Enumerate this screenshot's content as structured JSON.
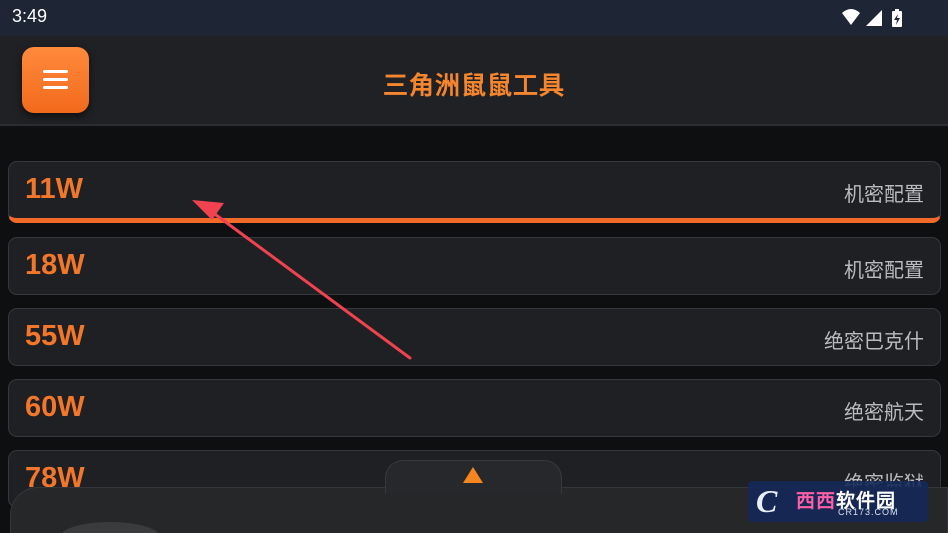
{
  "status_bar": {
    "time": "3:49",
    "icons": [
      "wifi-icon",
      "signal-icon",
      "battery-charging-icon"
    ]
  },
  "app_bar": {
    "menu_icon": "hamburger-menu-icon",
    "title": "三角洲鼠鼠工具",
    "accent_color": "#f5862e"
  },
  "list": {
    "items": [
      {
        "power": "11W",
        "label": "机密配置",
        "selected": true
      },
      {
        "power": "18W",
        "label": "机密配置",
        "selected": false
      },
      {
        "power": "55W",
        "label": "绝密巴克什",
        "selected": false
      },
      {
        "power": "60W",
        "label": "绝密航天",
        "selected": false
      },
      {
        "power": "78W",
        "label": "绝密监狱",
        "selected": false
      }
    ]
  },
  "bottom_sheet": {
    "expand_icon": "triangle-up-icon"
  },
  "watermark": {
    "logo_letter": "C",
    "brand_part1": "西西",
    "brand_part2": "软件园",
    "domain": "CR173.COM"
  }
}
